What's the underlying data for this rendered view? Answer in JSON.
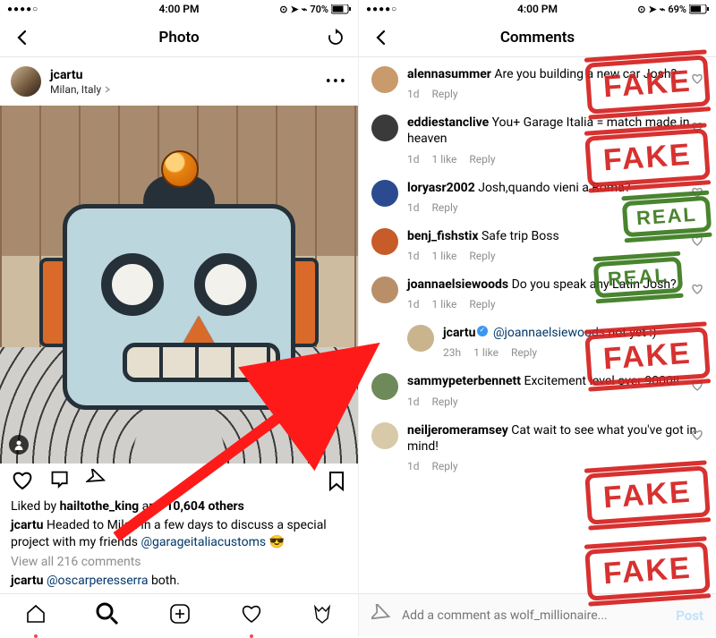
{
  "left": {
    "status_time": "4:00 PM",
    "battery": "70%",
    "nav_title": "Photo",
    "user": "jcartu",
    "location": "Milan, Italy",
    "likes_prefix": "Liked by ",
    "likes_user": "hailtothe_king",
    "likes_mid": " and ",
    "likes_count": "10,604 others",
    "caption_user": "jcartu",
    "caption_text": " Headed to Milan in a few days to discuss a special project with my friends ",
    "caption_mention": "@garageitaliacustoms",
    "caption_emoji": " 😎",
    "view_all": "View all 216 comments",
    "reply_user": "jcartu",
    "reply_mention": "@oscarperesserra",
    "reply_text": " both."
  },
  "right": {
    "status_time": "4:00 PM",
    "battery": "69%",
    "nav_title": "Comments",
    "comments": [
      {
        "user": "alennasummer",
        "text": " Are you building a new car Josh?",
        "time": "1d",
        "likes": "",
        "reply": "Reply",
        "stamp": "FAKE"
      },
      {
        "user": "eddiestanclive",
        "text": " You+ Garage Italia = match made in heaven",
        "time": "1d",
        "likes": "1 like",
        "reply": "Reply",
        "stamp": "FAKE"
      },
      {
        "user": "loryasr2002",
        "text": " Josh,quando vieni a Roma?",
        "time": "1d",
        "likes": "",
        "reply": "Reply",
        "stamp": "REAL"
      },
      {
        "user": "benj_fishstix",
        "text": " Safe trip Boss",
        "time": "1d",
        "likes": "1 like",
        "reply": "Reply",
        "stamp": "REAL"
      },
      {
        "user": "joannaelsiewoods",
        "text": " Do you speak any Latin Josh?",
        "time": "1d",
        "likes": "1 like",
        "reply": "Reply",
        "stamp": "FAKE"
      },
      {
        "user": "jcartu",
        "verified": true,
        "mention": "@joannaelsiewoods",
        "text": " not yet :)",
        "time": "23h",
        "likes": "1 like",
        "reply": "Reply",
        "isReply": true
      },
      {
        "user": "sammypeterbennett",
        "text": " Excitement level over 9000!!",
        "time": "1d",
        "likes": "",
        "reply": "Reply",
        "stamp": "FAKE"
      },
      {
        "user": "neiljeromeramsey",
        "text": " Cat wait to see what you've got in mind!",
        "time": "1d",
        "likes": "",
        "reply": "Reply",
        "stamp": "FAKE"
      }
    ],
    "add_placeholder": "Add a comment as wolf_millionaire...",
    "post_label": "Post"
  },
  "stamp_labels": {
    "fake": "FAKE",
    "real": "REAL"
  },
  "avatar_colors": [
    "#c99a6b",
    "#3a3a3a",
    "#2b4a8f",
    "#c75b2a",
    "#b98f6a",
    "#c9b48e",
    "#6e8a5a",
    "#d8c9a8"
  ]
}
